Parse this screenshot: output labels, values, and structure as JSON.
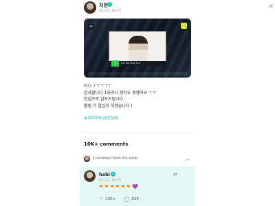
{
  "post": {
    "author": "지민",
    "timestamp": "03.23. 18:43",
    "verified_mark": "✓",
    "media": {
      "badge": "M!",
      "song": "Set Me Free Pt.2",
      "rank": "1"
    },
    "lines": [
      "아니 ㅜㅜㅜㅜㅜ",
      "감사합니다 1위라니 생각도 못했어요 ㅜㅜ",
      "진심으로 감사드립니다",
      "활동 더 열심히 하겠습니다 !"
    ],
    "hashtag": "#우리아미상받았네"
  },
  "comments": {
    "count_label": "10K+ comments",
    "artist_label": "1 comment from the artist"
  },
  "artist_comment": {
    "name": "hobi",
    "timestamp": "03.23. 19:53",
    "hearts": [
      "❤",
      "❤",
      "❤",
      "❤",
      "❤",
      "❤",
      "💜"
    ],
    "likes": "10K+",
    "replies": "839"
  },
  "icons": {
    "translate": "translate-icon",
    "chevron": "chevron-up-icon",
    "like": "like-icon",
    "reply": "reply-icon"
  },
  "colors": {
    "accent": "#19b5a8",
    "artist_card_bg": "#e4f8f4"
  }
}
